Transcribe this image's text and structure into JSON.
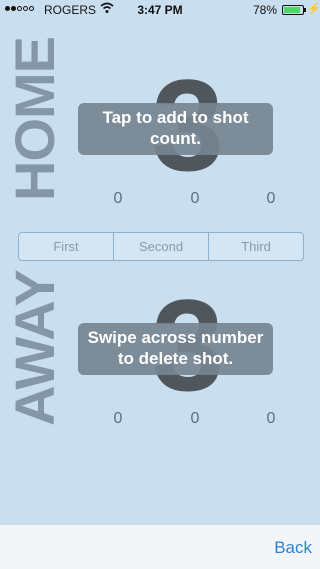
{
  "status_bar": {
    "carrier": "ROGERS",
    "time": "3:47 PM",
    "battery_percent": "78%",
    "battery_level": 0.78,
    "signal_bars_filled": 2,
    "signal_bars_total": 5
  },
  "home": {
    "label": "HOME",
    "count": "3",
    "hint": "Tap to add to shot count.",
    "periods": [
      "0",
      "0",
      "0"
    ]
  },
  "away": {
    "label": "AWAY",
    "count": "3",
    "hint": "Swipe across number to delete shot.",
    "periods": [
      "0",
      "0",
      "0"
    ]
  },
  "period_selector": {
    "segments": [
      "First",
      "Second",
      "Third"
    ]
  },
  "tab_bar": {
    "back_label": "Back"
  },
  "colors": {
    "background": "#c9dff0",
    "accent": "#2f80d6",
    "battery": "#4cd964"
  }
}
